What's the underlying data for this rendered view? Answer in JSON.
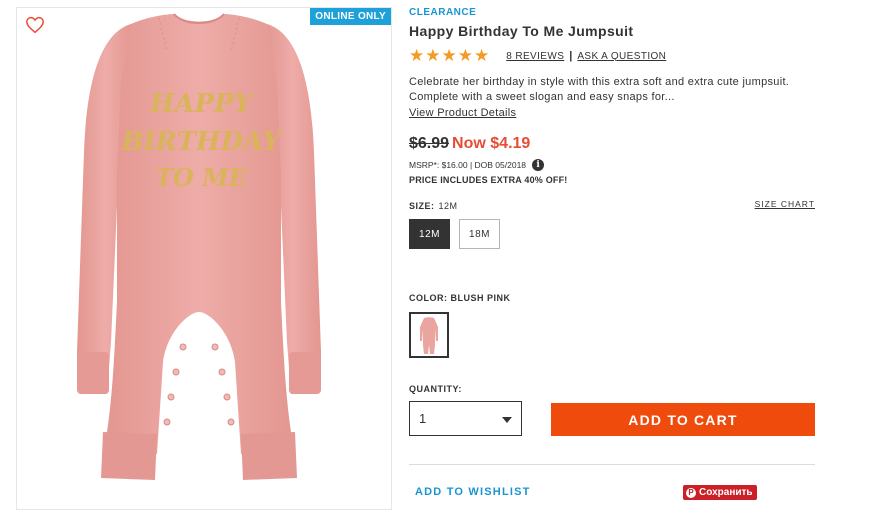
{
  "image_panel": {
    "badge": "ONLINE ONLY",
    "garment_print": [
      "HAPPY",
      "BIRTHDAY",
      "TO ME"
    ],
    "garment_color": "#eaa5a1",
    "wishlist_heart_color": "#e94b35"
  },
  "product": {
    "tag": "CLEARANCE",
    "title": "Happy Birthday To Me Jumpsuit",
    "rating": {
      "stars": "★★★★★",
      "value": 5,
      "max": 5
    },
    "reviews_link": "8 REVIEWS",
    "separator": "|",
    "ask_link": "ASK A QUESTION",
    "description": "Celebrate her birthday in style with this extra soft and extra cute jumpsuit. Complete with a sweet slogan and easy snaps for...",
    "view_details": "View Product Details"
  },
  "pricing": {
    "original": "$6.99",
    "now": "Now $4.19",
    "msrp": "MSRP*: $16.00 | DOB 05/2018",
    "info_icon": "info-icon",
    "note": "PRICE INCLUDES EXTRA 40% OFF!"
  },
  "size": {
    "label": "SIZE:",
    "selected": "12M",
    "chart_link": "SIZE CHART",
    "options": [
      "12M",
      "18M"
    ]
  },
  "color": {
    "label": "COLOR: BLUSH PINK"
  },
  "quantity": {
    "label": "QUANTITY:",
    "value": "1"
  },
  "actions": {
    "add_to_cart": "ADD TO CART",
    "add_to_wishlist": "ADD TO WISHLIST",
    "pinterest_save": "Сохранить",
    "pinterest_icon": "P"
  },
  "colors": {
    "accent_blue": "#1a95d3",
    "sale_red": "#e94b35",
    "cart_orange": "#ee4b0c",
    "star_orange": "#f59a23",
    "pinterest_red": "#cb2027"
  }
}
